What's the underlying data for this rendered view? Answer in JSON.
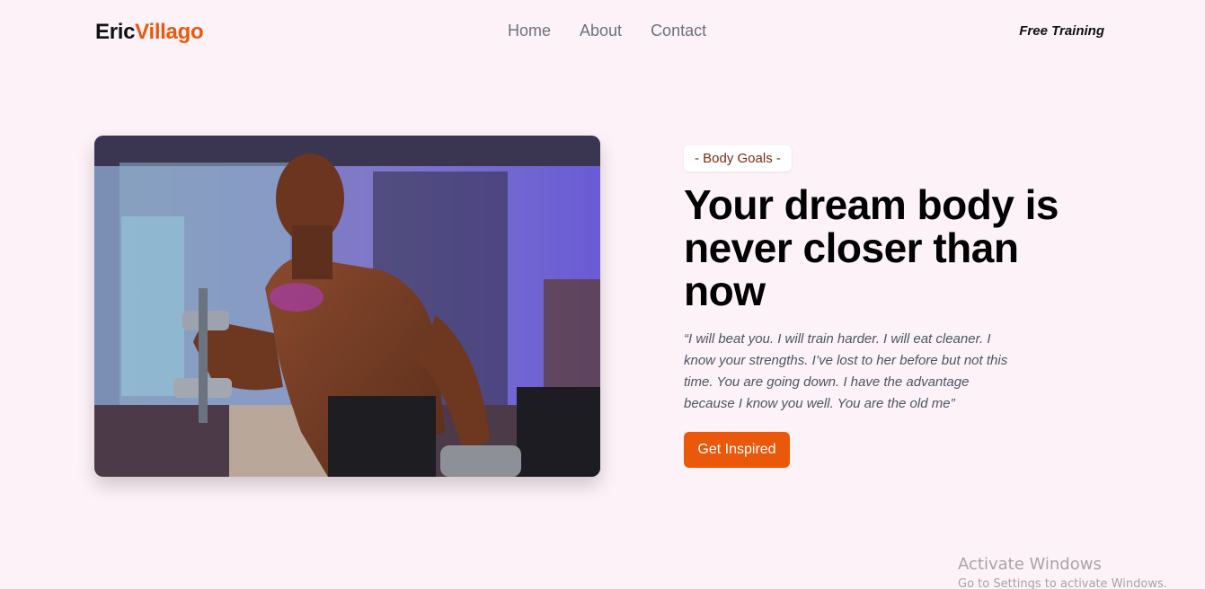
{
  "brand": {
    "first": "Eric",
    "last": "Villago",
    "accent_color": "#ea580c"
  },
  "nav": {
    "items": [
      {
        "label": "Home"
      },
      {
        "label": "About"
      },
      {
        "label": "Contact"
      }
    ]
  },
  "header": {
    "cta_label": "Free Training"
  },
  "hero": {
    "badge": "- Body Goals -",
    "title": "Your dream body is never closer than now",
    "quote": "“I will beat you. I will train harder. I will eat cleaner. I know your strengths. I’ve lost to her before but not this time. You are going down. I have the advantage because I know you well. You are the old me”",
    "button_label": "Get Inspired",
    "image_subject": "man-lifting-dumbbells-in-gym-photo"
  },
  "watermark": {
    "line1": "Activate Windows",
    "line2": "Go to Settings to activate Windows."
  },
  "colors": {
    "background": "#fdf2f8",
    "accent": "#ea580c",
    "nav_text": "#6b7280"
  }
}
